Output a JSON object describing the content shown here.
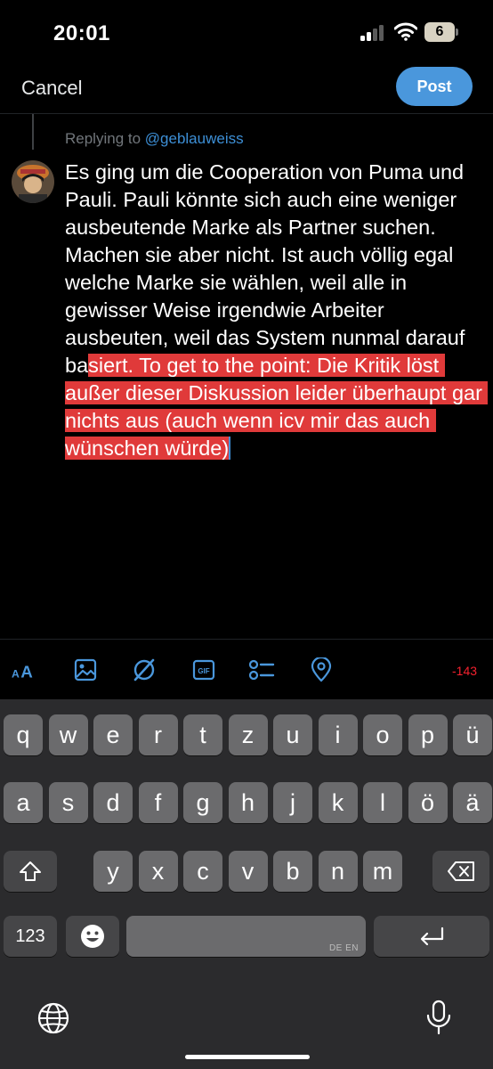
{
  "status_bar": {
    "time": "20:01",
    "battery_level": "6"
  },
  "header": {
    "cancel_label": "Cancel",
    "post_label": "Post"
  },
  "compose": {
    "replying_prefix": "Replying to ",
    "replying_handle": "@geblauweiss",
    "text_before_selection": "Es ging um die Cooperation von Puma und Pauli. Pauli könnte sich auch eine weniger ausbeutende Marke als Partner suchen. Machen sie aber nicht. Ist auch völlig egal welche Marke sie wählen, weil alle in gewisser Weise irgendwie Arbeiter ausbeuten, weil das System nunmal darauf ba",
    "text_selected": "siert. To get to the point: Die Kritik löst außer dieser Diskussion leider überhaupt gar nichts aus (auch wenn icv mir das auch wünschen würde)"
  },
  "toolbar": {
    "icons": [
      "text-size-icon",
      "image-icon",
      "gif-icon",
      "poll-icon",
      "location-icon"
    ],
    "text_size_label": "AA",
    "gif_label": "GIF",
    "char_count": "-143"
  },
  "keyboard": {
    "row1": [
      "q",
      "w",
      "e",
      "r",
      "t",
      "z",
      "u",
      "i",
      "o",
      "p",
      "ü"
    ],
    "row2": [
      "a",
      "s",
      "d",
      "f",
      "g",
      "h",
      "j",
      "k",
      "l",
      "ö",
      "ä"
    ],
    "row3": [
      "y",
      "x",
      "c",
      "v",
      "b",
      "n",
      "m"
    ],
    "numbers_label": "123",
    "space_languages": "DE EN"
  },
  "colors": {
    "accent": "#4a97dc",
    "selection": "#e03a3a",
    "warning": "#f4212e"
  }
}
